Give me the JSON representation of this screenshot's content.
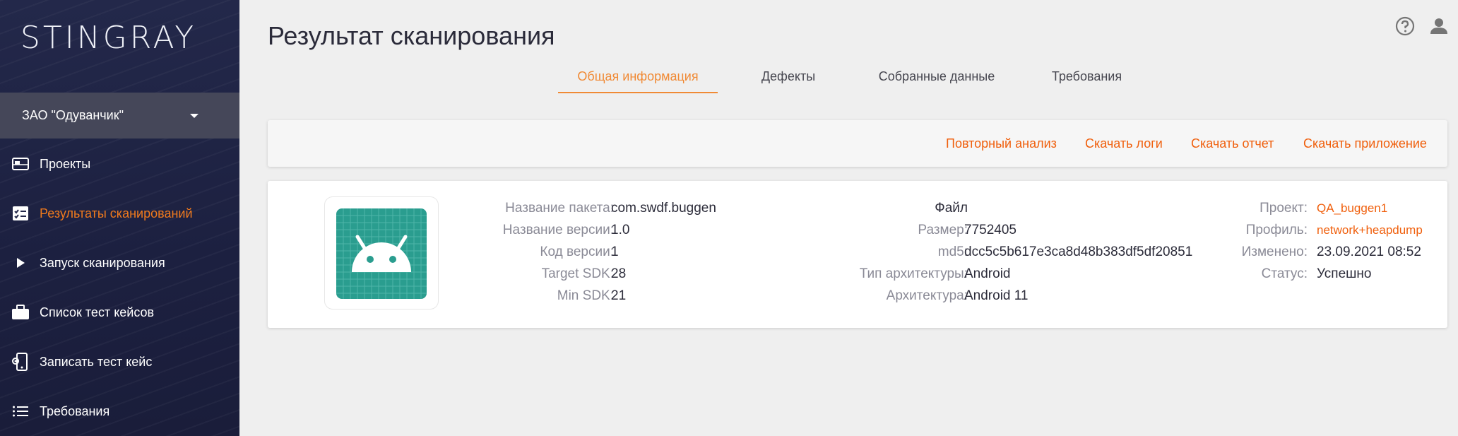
{
  "brand": {
    "logo_text": "STINGRAY"
  },
  "org_selector": {
    "name": "ЗАО \"Одуванчик\""
  },
  "sidebar": {
    "items": [
      {
        "label": "Проекты",
        "icon": "projects-icon",
        "active": false
      },
      {
        "label": "Результаты сканирований",
        "icon": "scan-results-icon",
        "active": true
      },
      {
        "label": "Запуск сканирования",
        "icon": "play-icon",
        "active": false
      },
      {
        "label": "Список тест кейсов",
        "icon": "briefcase-icon",
        "active": false
      },
      {
        "label": "Записать тест кейс",
        "icon": "phone-record-icon",
        "active": false
      },
      {
        "label": "Требования",
        "icon": "list-icon",
        "active": false
      }
    ]
  },
  "header": {
    "title": "Результат сканирования",
    "icons": [
      "help-icon",
      "user-icon"
    ]
  },
  "tabs": [
    {
      "label": "Общая информация",
      "active": true
    },
    {
      "label": "Дефекты",
      "active": false
    },
    {
      "label": "Собранные данные",
      "active": false
    },
    {
      "label": "Требования",
      "active": false
    }
  ],
  "actions": {
    "reanalyze": "Повторный анализ",
    "download_logs": "Скачать логи",
    "download_report": "Скачать отчет",
    "download_app": "Скачать приложение"
  },
  "app_info": {
    "package_name_label": "Название пакета:",
    "package_name": "com.swdf.buggen",
    "version_name_label": "Название версии:",
    "version_name": "1.0",
    "version_code_label": "Код версии:",
    "version_code": "1",
    "target_sdk_label": "Target SDK:",
    "target_sdk": "28",
    "min_sdk_label": "Min SDK:",
    "min_sdk": "21"
  },
  "file_info": {
    "heading": "Файл",
    "size_label": "Размер:",
    "size": "7752405",
    "md5_label": "md5:",
    "md5": "dcc5c5b617e3ca8d48b383df5df20851",
    "arch_type_label": "Тип архитектуры:",
    "arch_type": "Android",
    "arch_label": "Архитектура:",
    "arch": "Android 11"
  },
  "scan_info": {
    "project_label": "Проект:",
    "project": "QA_buggen1",
    "profile_label": "Профиль:",
    "profile": "network+heapdump",
    "modified_label": "Изменено:",
    "modified": "23.09.2021 08:52",
    "status_label": "Статус:",
    "status": "Успешно"
  },
  "colors": {
    "accent": "#f05f0c",
    "tab_accent": "#f08a35",
    "sidebar_bg": "#1f2340",
    "selector_bg": "#454759",
    "app_icon_bg": "#2a9d8f"
  }
}
